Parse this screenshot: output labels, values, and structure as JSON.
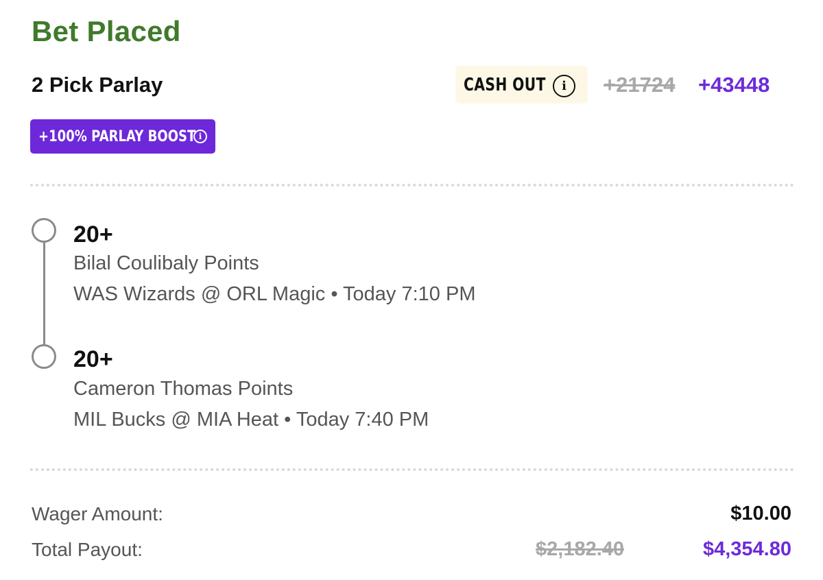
{
  "header": {
    "title": "Bet Placed"
  },
  "bet": {
    "type_label": "2 Pick Parlay",
    "cash_out_label": "CASH OUT",
    "cash_out_info_glyph": "i",
    "odds_original": "+21724",
    "odds_boosted": "+43448",
    "boost_label": "+100% PARLAY BOOST",
    "boost_info_glyph": "i"
  },
  "picks": [
    {
      "line": "20+",
      "player_market": "Bilal Coulibaly Points",
      "game": "WAS Wizards @ ORL Magic • Today 7:10 PM"
    },
    {
      "line": "20+",
      "player_market": "Cameron Thomas Points",
      "game": "MIL Bucks @ MIA Heat • Today 7:40 PM"
    }
  ],
  "summary": {
    "wager_label": "Wager Amount:",
    "wager_value": "$10.00",
    "payout_label": "Total Payout:",
    "payout_original": "$2,182.40",
    "payout_boosted": "$4,354.80"
  },
  "colors": {
    "title_green": "#3f7a2c",
    "accent_purple": "#6c2bd9",
    "boost_bg": "#6d28d9",
    "cashout_bg": "#fdf8e6",
    "strike_gray": "#a8a8a8"
  },
  "icons": {
    "cash_out_info": "info-circle-icon",
    "boost_info": "info-circle-icon",
    "pick_marker": "timeline-circle-icon"
  }
}
